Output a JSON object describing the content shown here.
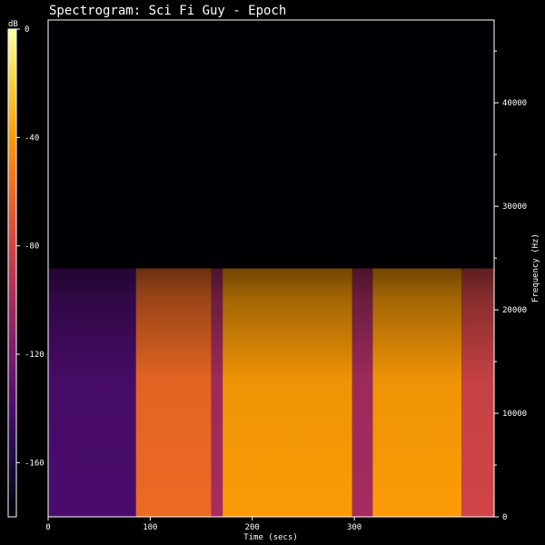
{
  "chart_data": {
    "type": "heatmap",
    "title": "Spectrogram: Sci Fi Guy - Epoch",
    "xlabel": "Time (secs)",
    "ylabel": "Frequency (Hz)",
    "colorbar_label": "dB",
    "xlim": [
      0,
      437
    ],
    "ylim": [
      0,
      48000
    ],
    "x_ticks": [
      0,
      100,
      200,
      300
    ],
    "y_ticks": [
      0,
      10000,
      20000,
      30000,
      40000
    ],
    "y_tick_labels_visible": [
      "0",
      "10000",
      "20000",
      "30000",
      "40000"
    ],
    "clim": [
      -180,
      0
    ],
    "colorbar_ticks": [
      0,
      -40,
      -80,
      -120,
      -160
    ],
    "colormap": [
      "#000004",
      "#1b0c41",
      "#4a0c6b",
      "#781c6d",
      "#a52c60",
      "#cf4446",
      "#ed6925",
      "#fb9b06",
      "#f7d13d",
      "#fcffa4"
    ],
    "cutoff_frequency_hz": 24000,
    "time_segments": [
      {
        "start": 0,
        "end": 86,
        "level_db": -140
      },
      {
        "start": 86,
        "end": 160,
        "level_db": -70
      },
      {
        "start": 160,
        "end": 171,
        "level_db": -110
      },
      {
        "start": 171,
        "end": 298,
        "level_db": -45
      },
      {
        "start": 298,
        "end": 318,
        "level_db": -100
      },
      {
        "start": 318,
        "end": 405,
        "level_db": -50
      },
      {
        "start": 405,
        "end": 437,
        "level_db": -90
      }
    ]
  }
}
